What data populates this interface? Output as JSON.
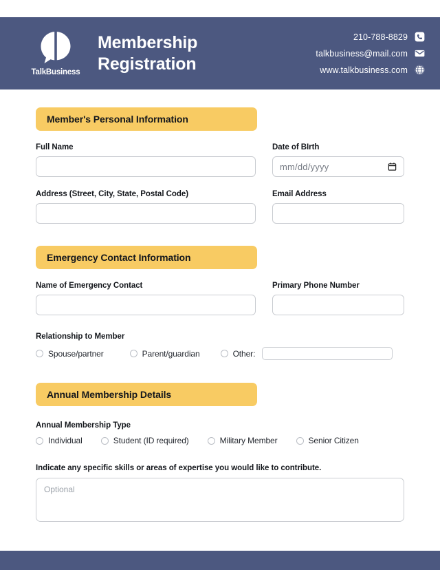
{
  "header": {
    "logo_wordmark": "TalkBusiness",
    "title_line1": "Membership",
    "title_line2": "Registration",
    "contacts": [
      {
        "text": "210-788-8829",
        "icon": "phone-icon"
      },
      {
        "text": "talkbusiness@mail.com",
        "icon": "mail-icon"
      },
      {
        "text": "www.talkbusiness.com",
        "icon": "globe-icon"
      }
    ]
  },
  "sections": {
    "personal": {
      "band_label": "Member's Personal Information",
      "full_name_label": "Full Name",
      "full_name_value": "",
      "full_name_placeholder": "",
      "dob_label": "Date of BIrth",
      "dob_placeholder": "mm/dd/yyyy",
      "address_label": "Address (Street, City, State, Postal Code)",
      "address_value": "",
      "email_label": "Email Address",
      "email_value": ""
    },
    "emergency": {
      "band_label": "Emergency Contact Information",
      "contact_name_label": "Name of Emergency Contact",
      "contact_name_value": "",
      "phone_label": "Primary Phone Number",
      "phone_value": "",
      "relationship_label": "Relationship to Member",
      "relationship_options": [
        "Spouse/partner",
        "Parent/guardian",
        "Other:"
      ],
      "other_value": ""
    },
    "membership": {
      "band_label": "Annual Membership Details",
      "type_label": "Annual Membership Type",
      "type_options": [
        "Individual",
        "Student (ID required)",
        "Military Member",
        "Senior Citizen"
      ],
      "skills_label": "Indicate any specific skills or areas of expertise you would like to contribute.",
      "skills_placeholder": "Optional",
      "skills_value": ""
    }
  },
  "colors": {
    "brand_blue": "#4C5880",
    "accent_yellow": "#F8CB63",
    "text_dark": "#14171C",
    "border_gray": "#C9CCD1"
  }
}
